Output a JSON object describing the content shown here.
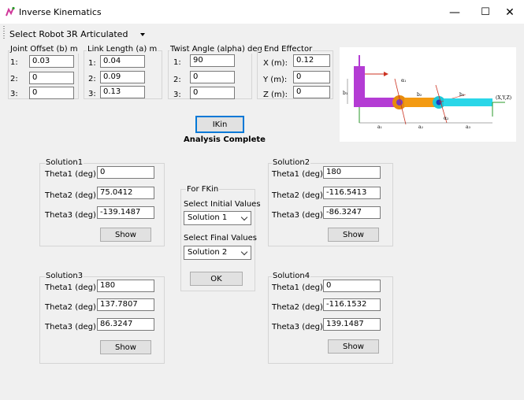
{
  "window": {
    "title": "Inverse Kinematics",
    "controls": {
      "minimize": "—",
      "maximize": "☐",
      "close": "✕"
    }
  },
  "toolbar": {
    "select_robot_label": "Select Robot:",
    "robot_value": "3R Articulated"
  },
  "inputs": {
    "joint_offset": {
      "title": "Joint Offset (b) m",
      "rows": [
        {
          "index": "1:",
          "value": "0.03"
        },
        {
          "index": "2:",
          "value": "0"
        },
        {
          "index": "3:",
          "value": "0"
        }
      ]
    },
    "link_length": {
      "title": "Link Length (a) m",
      "rows": [
        {
          "index": "1:",
          "value": "0.04"
        },
        {
          "index": "2:",
          "value": "0.09"
        },
        {
          "index": "3:",
          "value": "0.13"
        }
      ]
    },
    "twist_angle": {
      "title": "Twist Angle (alpha) deg",
      "rows": [
        {
          "index": "1:",
          "value": "90"
        },
        {
          "index": "2:",
          "value": "0"
        },
        {
          "index": "3:",
          "value": "0"
        }
      ]
    },
    "end_effector": {
      "title": "End Effector",
      "rows": [
        {
          "index": "X (m):",
          "value": "0.12"
        },
        {
          "index": "Y (m):",
          "value": "0"
        },
        {
          "index": "Z (m):",
          "value": "0"
        }
      ]
    }
  },
  "diagram": {
    "labels": {
      "b1": "b₁",
      "a1": "a₁",
      "a2": "a₂",
      "a3": "a₃",
      "b2": "b₂",
      "alpha1": "α₁",
      "alpha2": "α₂",
      "end": "(X,Y,Z)"
    }
  },
  "ikin_button": "IKin",
  "status": "Analysis Complete",
  "solutions": [
    {
      "title": "Solution1",
      "theta1_label": "Theta1 (deg):",
      "theta1": "0",
      "theta2_label": "Theta2 (deg):",
      "theta2": "75.0412",
      "theta3_label": "Theta3 (deg):",
      "theta3": "-139.1487",
      "show": "Show"
    },
    {
      "title": "Solution2",
      "theta1_label": "Theta1 (deg):",
      "theta1": "180",
      "theta2_label": "Theta2 (deg):",
      "theta2": "-116.5413",
      "theta3_label": "Theta3 (deg):",
      "theta3": "-86.3247",
      "show": "Show"
    },
    {
      "title": "Solution3",
      "theta1_label": "Theta1 (deg):",
      "theta1": "180",
      "theta2_label": "Theta2 (deg):",
      "theta2": "137.7807",
      "theta3_label": "Theta3 (deg):",
      "theta3": "86.3247",
      "show": "Show"
    },
    {
      "title": "Solution4",
      "theta1_label": "Theta1 (deg):",
      "theta1": "0",
      "theta2_label": "Theta2 (deg):",
      "theta2": "-116.1532",
      "theta3_label": "Theta3 (deg):",
      "theta3": "139.1487",
      "show": "Show"
    }
  ],
  "fkin": {
    "title": "For FKin",
    "initial_label": "Select Initial Values",
    "initial_value": "Solution 1",
    "final_label": "Select Final Values",
    "final_value": "Solution 2",
    "ok": "OK"
  }
}
